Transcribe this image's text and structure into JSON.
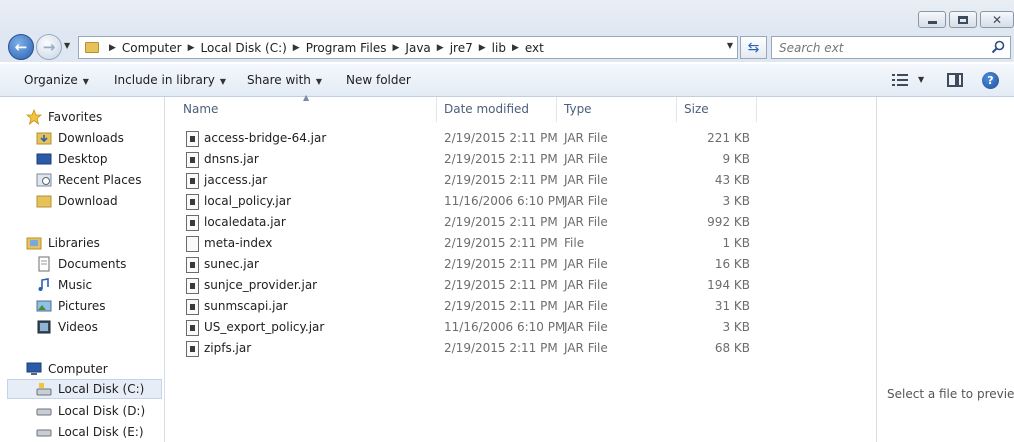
{
  "window": {
    "minimize_glyph": "minimize-icon",
    "maximize_glyph": "maximize-icon",
    "close_glyph": "✕"
  },
  "address": {
    "crumbs": [
      "Computer",
      "Local Disk (C:)",
      "Program Files",
      "Java",
      "jre7",
      "lib",
      "ext"
    ]
  },
  "search": {
    "placeholder": "Search ext"
  },
  "commands": {
    "organize": "Organize",
    "include": "Include in library",
    "share": "Share with",
    "new_folder": "New folder"
  },
  "nav": {
    "favorites": "Favorites",
    "downloads": "Downloads",
    "desktop": "Desktop",
    "recent": "Recent Places",
    "download": "Download",
    "libraries": "Libraries",
    "documents": "Documents",
    "music": "Music",
    "pictures": "Pictures",
    "videos": "Videos",
    "computer": "Computer",
    "disk_c": "Local Disk (C:)",
    "disk_d": "Local Disk (D:)",
    "disk_e": "Local Disk (E:)"
  },
  "columns": {
    "name": "Name",
    "date": "Date modified",
    "type": "Type",
    "size": "Size"
  },
  "files": [
    {
      "name": "access-bridge-64.jar",
      "date": "2/19/2015 2:11 PM",
      "type": "JAR File",
      "size": "221 KB"
    },
    {
      "name": "dnsns.jar",
      "date": "2/19/2015 2:11 PM",
      "type": "JAR File",
      "size": "9 KB"
    },
    {
      "name": "jaccess.jar",
      "date": "2/19/2015 2:11 PM",
      "type": "JAR File",
      "size": "43 KB"
    },
    {
      "name": "local_policy.jar",
      "date": "11/16/2006 6:10 PM",
      "type": "JAR File",
      "size": "3 KB"
    },
    {
      "name": "localedata.jar",
      "date": "2/19/2015 2:11 PM",
      "type": "JAR File",
      "size": "992 KB"
    },
    {
      "name": "meta-index",
      "date": "2/19/2015 2:11 PM",
      "type": "File",
      "size": "1 KB"
    },
    {
      "name": "sunec.jar",
      "date": "2/19/2015 2:11 PM",
      "type": "JAR File",
      "size": "16 KB"
    },
    {
      "name": "sunjce_provider.jar",
      "date": "2/19/2015 2:11 PM",
      "type": "JAR File",
      "size": "194 KB"
    },
    {
      "name": "sunmscapi.jar",
      "date": "2/19/2015 2:11 PM",
      "type": "JAR File",
      "size": "31 KB"
    },
    {
      "name": "US_export_policy.jar",
      "date": "11/16/2006 6:10 PM",
      "type": "JAR File",
      "size": "3 KB"
    },
    {
      "name": "zipfs.jar",
      "date": "2/19/2015 2:11 PM",
      "type": "JAR File",
      "size": "68 KB"
    }
  ],
  "preview": {
    "message": "Select a file to preview."
  }
}
